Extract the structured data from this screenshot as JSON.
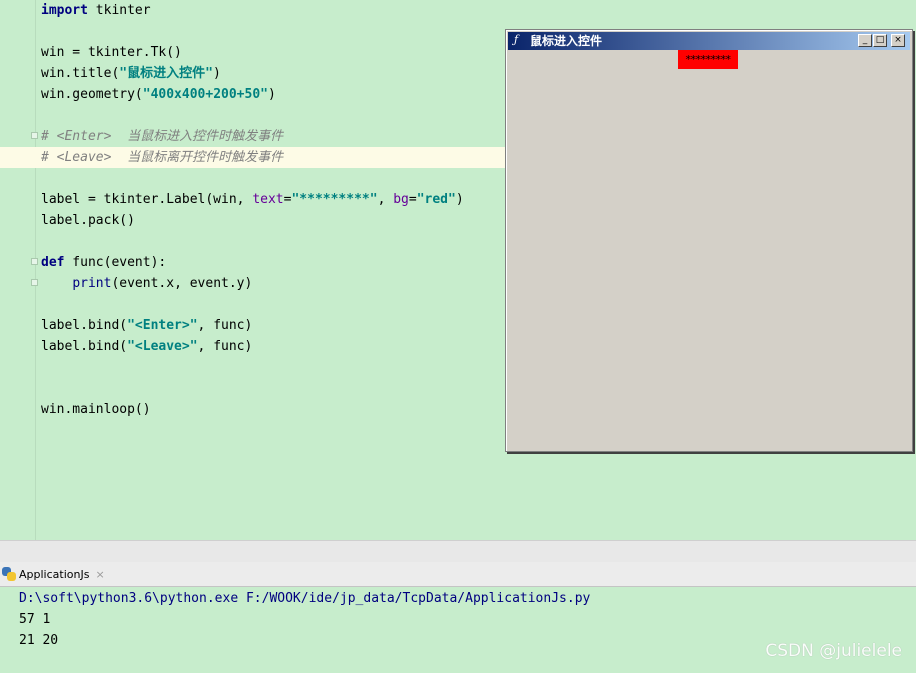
{
  "editor": {
    "lines": [
      {
        "text": ""
      },
      {
        "text": ""
      },
      {
        "text": ""
      },
      {
        "text": ""
      },
      {
        "text": ""
      }
    ],
    "code": {
      "l1_kw": "import",
      "l1_rest": " tkinter",
      "l3": "win = tkinter.Tk()",
      "l4_a": "win.title(",
      "l4_str": "\"鼠标进入控件\"",
      "l4_b": ")",
      "l5_a": "win.geometry(",
      "l5_str": "\"400x400+200+50\"",
      "l5_b": ")",
      "l7": "# <Enter>  当鼠标进入控件时触发事件",
      "l8": "# <Leave>  当鼠标离开控件时触发事件",
      "l10_a": "label = tkinter.Label(win, ",
      "l10_kw1": "text",
      "l10_b": "=",
      "l10_str1": "\"*********\"",
      "l10_c": ", ",
      "l10_kw2": "bg",
      "l10_d": "=",
      "l10_str2": "\"red\"",
      "l10_e": ")",
      "l11": "label.pack()",
      "l13_kw": "def",
      "l13_rest": " func(event):",
      "l14_indent": "    ",
      "l14_builtin": "print",
      "l14_rest": "(event.x, event.y)",
      "l16_a": "label.bind(",
      "l16_str": "\"<Enter>\"",
      "l16_b": ", func)",
      "l17_a": "label.bind(",
      "l17_str": "\"<Leave>\"",
      "l17_b": ", func)",
      "l20": "win.mainloop()"
    }
  },
  "tk_window": {
    "title": "鼠标进入控件",
    "feather_icon": "tk-feather-icon",
    "minimize_glyph": "_",
    "maximize_glyph": "□",
    "close_glyph": "×",
    "label_text": "*********",
    "label_color": "#ff0000"
  },
  "run_panel": {
    "tab_label": "ApplicationJs",
    "tab_close": "×",
    "command": "D:\\soft\\python3.6\\python.exe F:/WOOK/ide/jp_data/TcpData/ApplicationJs.py",
    "output": [
      "57 1",
      "21 20"
    ]
  },
  "watermark": "CSDN @julielele"
}
